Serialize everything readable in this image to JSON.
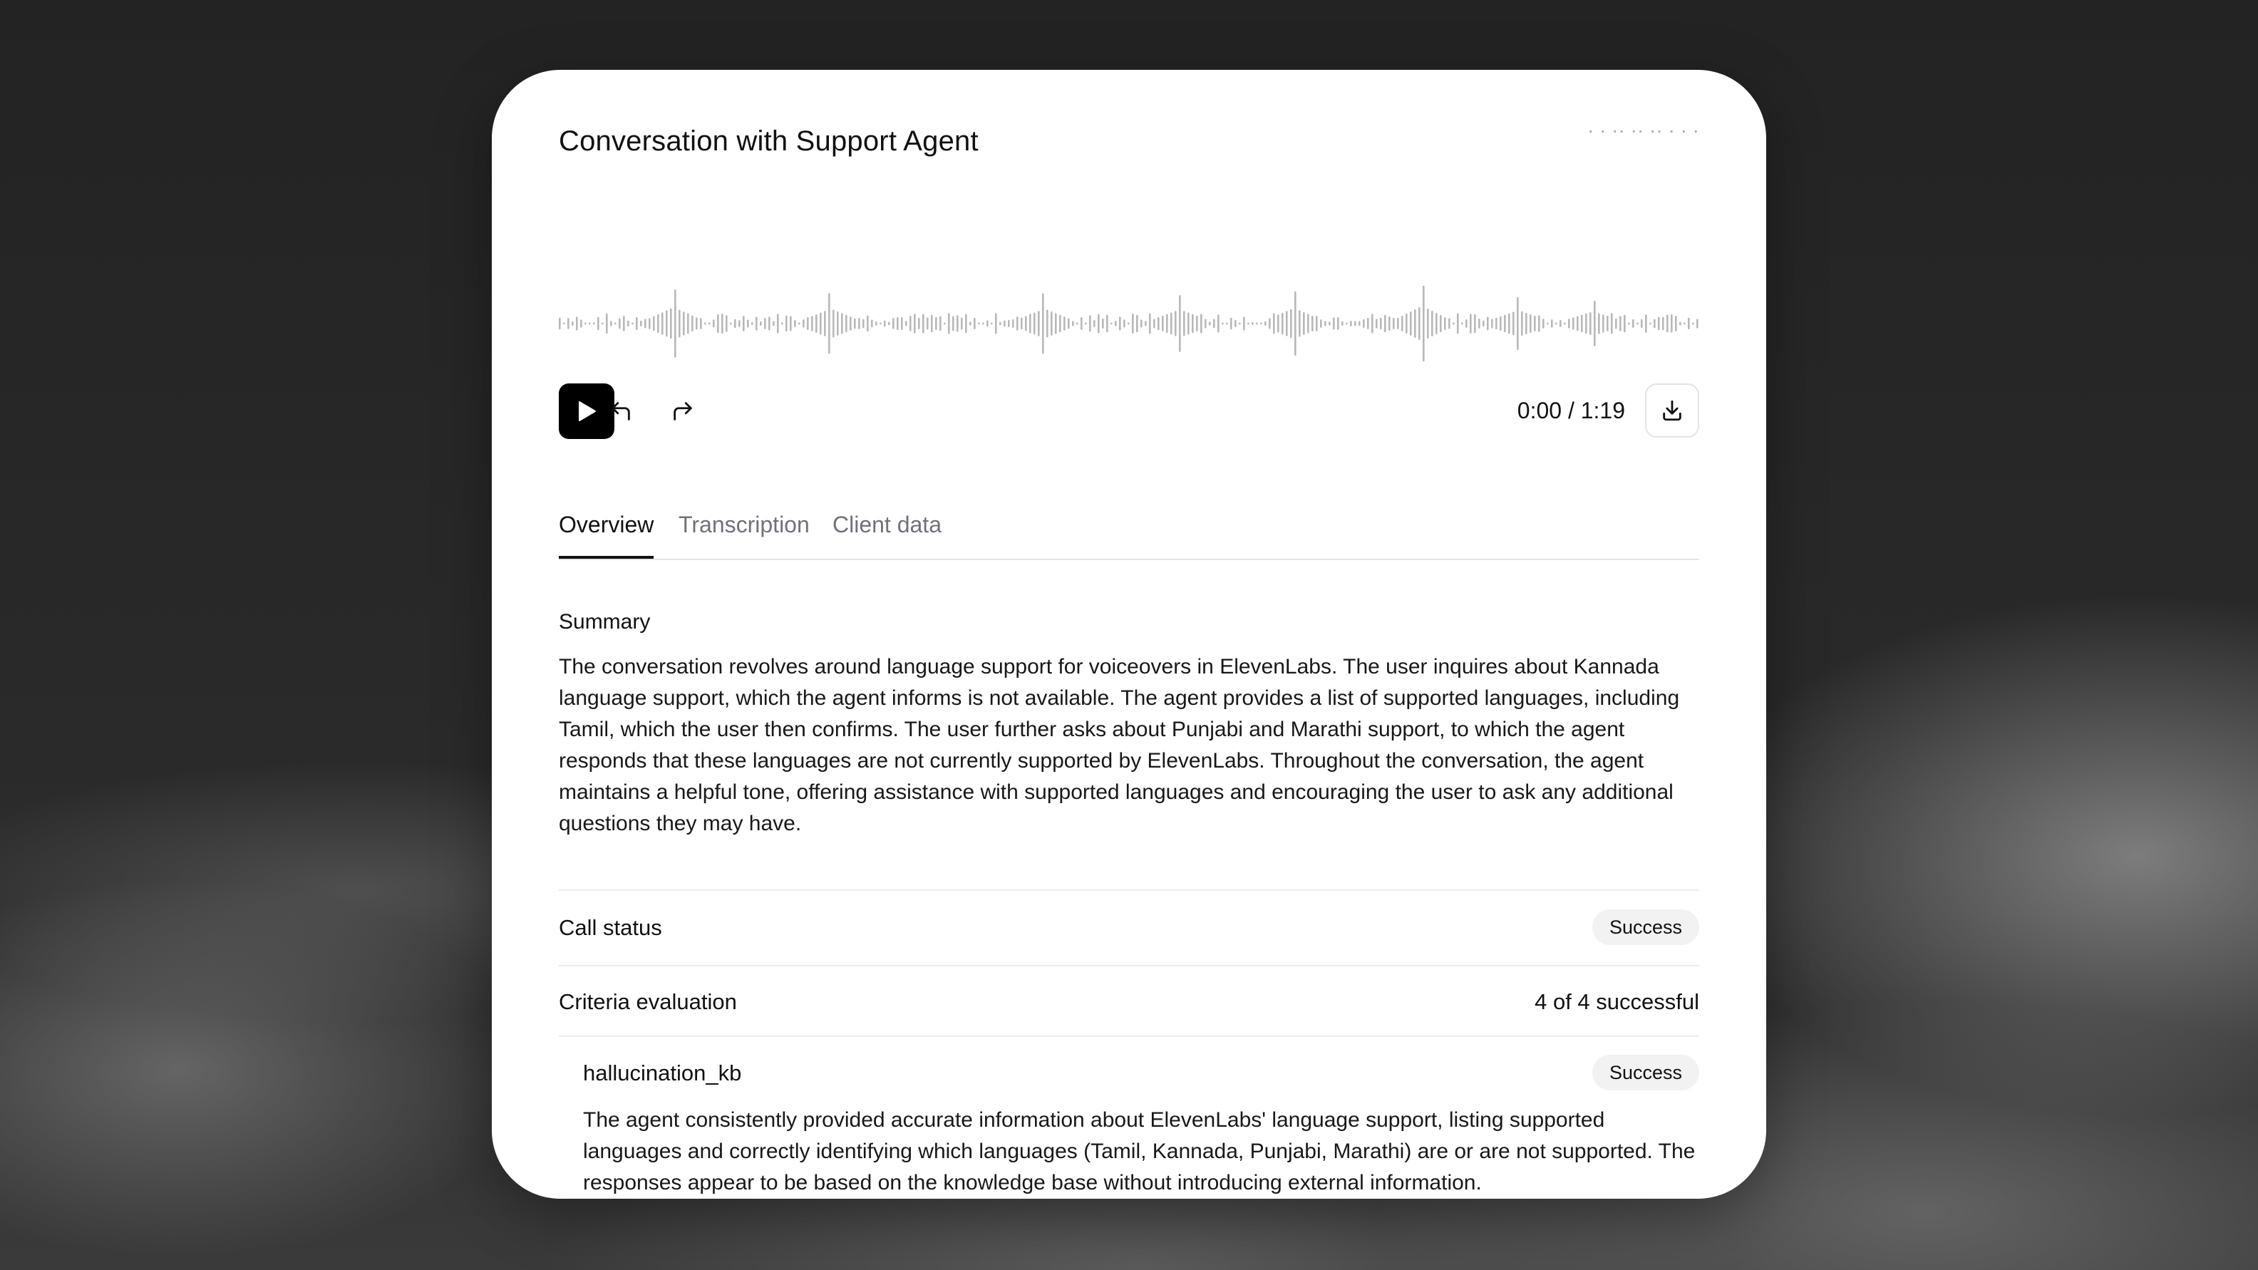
{
  "header": {
    "title": "Conversation with Support Agent",
    "right_cutoff_text": "· ·   ·· ·· ··  ·  ·  ·"
  },
  "player": {
    "time_display": "0:00 / 1:19",
    "play_icon": "play-icon",
    "rewind_icon": "rewind-icon",
    "forward_icon": "forward-icon",
    "download_icon": "download-icon"
  },
  "tabs": [
    {
      "label": "Overview",
      "active": true
    },
    {
      "label": "Transcription",
      "active": false
    },
    {
      "label": "Client data",
      "active": false
    }
  ],
  "summary": {
    "heading": "Summary",
    "text": "The conversation revolves around language support for voiceovers in ElevenLabs. The user inquires about Kannada language support, which the agent informs is not available. The agent provides a list of supported languages, including Tamil, which the user then confirms. The user further asks about Punjabi and Marathi support, to which the agent responds that these languages are not currently supported by ElevenLabs. Throughout the conversation, the agent maintains a helpful tone, offering assistance with supported languages and encouraging the user to ask any additional questions they may have."
  },
  "call_status": {
    "label": "Call status",
    "badge": "Success"
  },
  "criteria": {
    "label": "Criteria evaluation",
    "value": "4 of 4 successful",
    "items": [
      {
        "name": "hallucination_kb",
        "badge": "Success",
        "text": "The agent consistently provided accurate information about ElevenLabs' language support, listing supported languages and correctly identifying which languages (Tamil, Kannada, Punjabi, Marathi) are or are not supported. The responses appear to be based on the knowledge base without introducing external information."
      }
    ]
  },
  "colors": {
    "accent": "#000000",
    "muted_text": "#71717a",
    "badge_bg": "#f2f2f3",
    "waveform": "#b8b8b8"
  }
}
